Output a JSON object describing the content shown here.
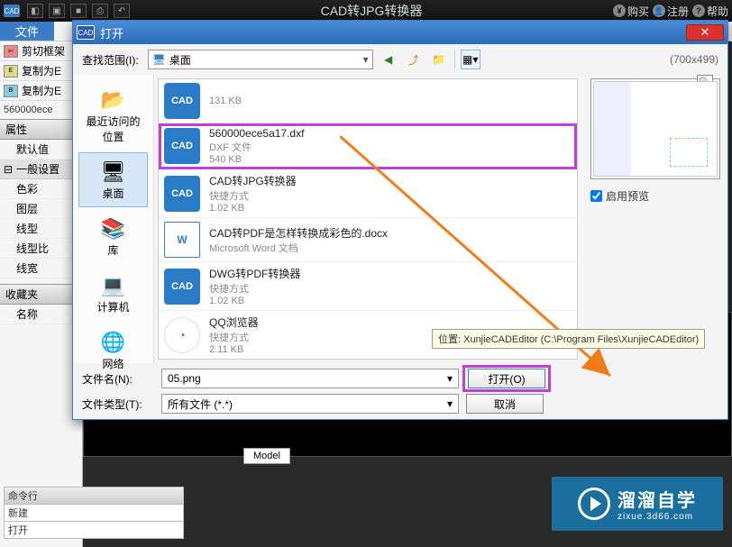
{
  "app": {
    "icon_label": "CAD",
    "title": "CAD转JPG转换器",
    "buy": "购买",
    "register": "注册",
    "help": "帮助"
  },
  "ribbon": {
    "file": "文件"
  },
  "left_panel": {
    "btn_cut": "剪切框架",
    "btn_copy": "复制为E",
    "btn_copy2": "复制为E",
    "file_shown": "560000ece",
    "prop_header": "属性",
    "default": "默认值",
    "general": "一般设置",
    "rows": [
      "色彩",
      "图层",
      "线型",
      "线型比",
      "线宽"
    ],
    "fav_header": "收藏夹",
    "fav_row": "名称"
  },
  "viewport": {
    "tab": "Model"
  },
  "cmd": {
    "header": "命令行",
    "lines": [
      "新建",
      "打开"
    ]
  },
  "dialog": {
    "icon_label": "CAD",
    "title": "打开",
    "lookin_label": "查找范围(I):",
    "lookin_value": "桌面",
    "preview_size": "(700x499)",
    "places": [
      "最近访问的位置",
      "桌面",
      "库",
      "计算机",
      "网络"
    ],
    "selected_place_index": 1,
    "files": [
      {
        "icon": "cad",
        "name_prefix": "",
        "size_only": "131 KB"
      },
      {
        "icon": "cad",
        "name": "560000ece5a17.dxf",
        "sub1": "DXF 文件",
        "sub2": "540 KB",
        "highlight": true
      },
      {
        "icon": "cad",
        "name": "CAD转JPG转换器",
        "sub1": "快捷方式",
        "sub2": "1.02 KB"
      },
      {
        "icon": "docx",
        "name": "CAD转PDF是怎样转换成彩色的.docx",
        "sub1": "Microsoft Word 文档",
        "sub2": ""
      },
      {
        "icon": "cad",
        "name": "DWG转PDF转换器",
        "sub1": "快捷方式",
        "sub2": "1.02 KB"
      },
      {
        "icon": "qq",
        "name": "QQ浏览器",
        "sub1": "快捷方式",
        "sub2": "2.11 KB"
      }
    ],
    "tooltip": "位置: XunjieCADEditor (C:\\Program Files\\XunjieCADEditor)",
    "enable_preview": "启用预览",
    "filename_label": "文件名(N):",
    "filename_value": "05.png",
    "filetype_label": "文件类型(T):",
    "filetype_value": "所有文件 (*.*)",
    "open_btn": "打开(O)",
    "cancel_btn": "取消"
  },
  "watermark": {
    "t1": "溜溜自学",
    "t2": "zixue.3d66.com"
  }
}
